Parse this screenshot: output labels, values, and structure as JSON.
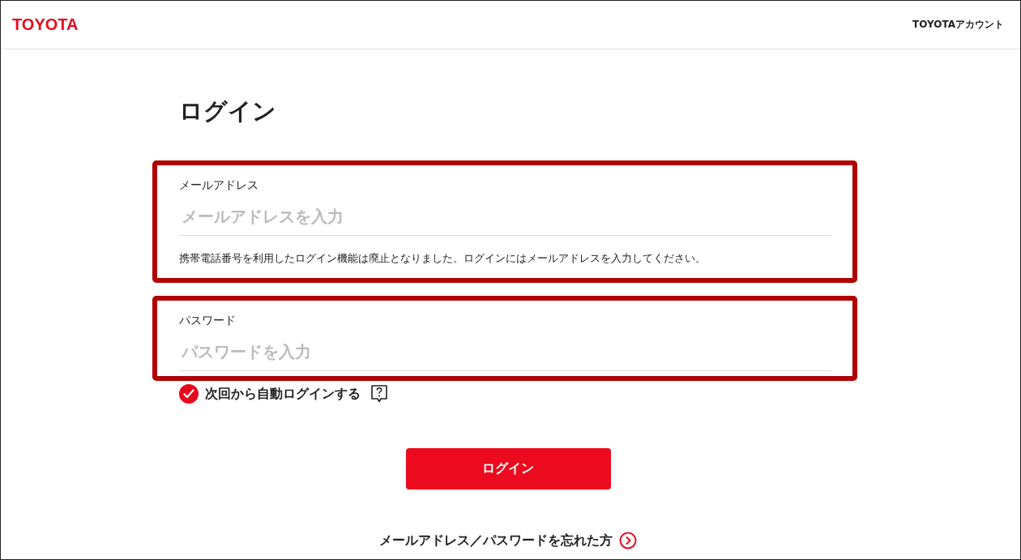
{
  "header": {
    "logo": "TOYOTA",
    "account_link": "TOYOTAアカウント"
  },
  "title": "ログイン",
  "fields": [
    {
      "label": "メールアドレス",
      "placeholder": "メールアドレスを入力",
      "note": "携帯電話番号を利用したログイン機能は廃止となりました。ログインにはメールアドレスを入力してください。",
      "annotated": true
    },
    {
      "label": "パスワード",
      "placeholder": "パスワードを入力",
      "annotated": true
    }
  ],
  "remember": {
    "label": "次回から自動ログインする",
    "checked": true
  },
  "login_button": "ログイン",
  "forgot_link": "メールアドレス／パスワードを忘れた方"
}
